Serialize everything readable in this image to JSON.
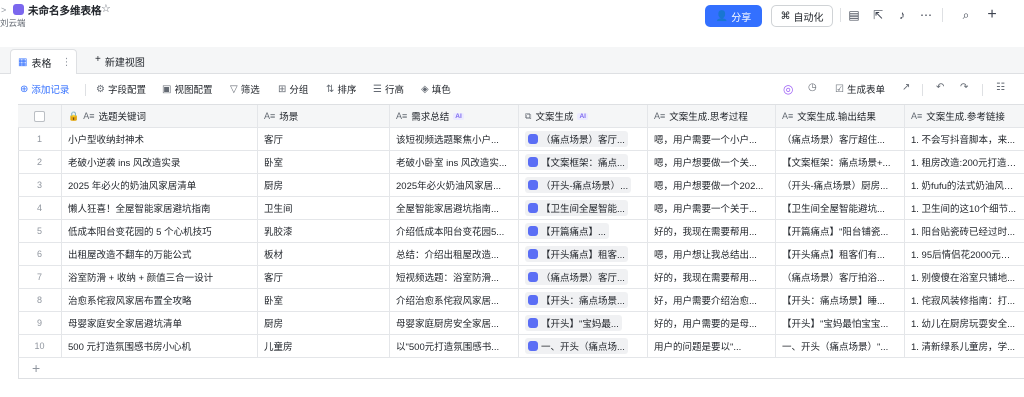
{
  "header": {
    "title": "未命名多维表格",
    "owner": "刘云端",
    "share_label": "分享",
    "automation_label": "自动化"
  },
  "views": {
    "active_tab": "表格",
    "new_view": "新建视图"
  },
  "toolbar": {
    "add_record": "添加记录",
    "field_config": "字段配置",
    "view_config": "视图配置",
    "filter": "筛选",
    "group": "分组",
    "sort": "排序",
    "row_height": "行高",
    "fill_color": "填色",
    "generate_table": "生成表单"
  },
  "columns": [
    {
      "label": "选题关键词",
      "icon": "text-icon",
      "ai": false
    },
    {
      "label": "场景",
      "icon": "text-icon",
      "ai": false
    },
    {
      "label": "需求总结",
      "icon": "text-icon",
      "ai": true
    },
    {
      "label": "文案生成",
      "icon": "copy-icon",
      "ai": true
    },
    {
      "label": "文案生成.思考过程",
      "icon": "text-icon",
      "ai": false
    },
    {
      "label": "文案生成.输出结果",
      "icon": "text-icon",
      "ai": false
    },
    {
      "label": "文案生成.参考链接",
      "icon": "text-icon",
      "ai": false
    }
  ],
  "rows": [
    {
      "n": "1",
      "c1": "小户型收纳封神术",
      "c2": "客厅",
      "c3": "该短视频选题聚焦小户...",
      "c4": "（痛点场景）客厅...",
      "c5": "嗯，用户需要一个小户...",
      "c6": "（痛点场景）客厅超住...",
      "c7": "1. 不会写抖音脚本，来..."
    },
    {
      "n": "2",
      "c1": "老破小逆袭 ins 风改造实录",
      "c2": "卧室",
      "c3": "老破小卧室 ins 风改造实...",
      "c4": "【文案框架：痛点...",
      "c5": "嗯，用户想要做一个关...",
      "c6": "【文案框架：痛点场景+...",
      "c7": "1. 租房改造:200元打造in..."
    },
    {
      "n": "3",
      "c1": "2025 年必火的奶油风家居清单",
      "c2": "厨房",
      "c3": "2025年必火奶油风家居...",
      "c4": "（开头-痛点场景）...",
      "c5": "嗯，用户想要做一个202...",
      "c6": "（开头-痛点场景）厨房...",
      "c7": "1. 奶fufu的法式奶油风厨..."
    },
    {
      "n": "4",
      "c1": "懒人狂喜！全屋智能家居避坑指南",
      "c2": "卫生间",
      "c3": "全屋智能家居避坑指南...",
      "c4": "【卫生间全屋智能...",
      "c5": "嗯，用户需要一个关于...",
      "c6": "【卫生间全屋智能避坑...",
      "c7": "1. 卫生间的这10个细节..."
    },
    {
      "n": "5",
      "c1": "低成本阳台变花园的 5 个心机技巧",
      "c2": "乳胶漆",
      "c3": "介绍低成本阳台变花园5...",
      "c4": "【开篇痛点】...",
      "c5": "好的，我现在需要帮用...",
      "c6": "【开篇痛点】\"阳台铺瓷...",
      "c7": "1. 阳台贴瓷砖已经过时..."
    },
    {
      "n": "6",
      "c1": "出租屋改造不翻车的万能公式",
      "c2": "板材",
      "c3": "总结：介绍出租屋改造...",
      "c4": "【开头痛点】租客...",
      "c5": "嗯，用户想让我总结出...",
      "c6": "【开头痛点】租客们有...",
      "c7": "1. 95后情侣花2000元将..."
    },
    {
      "n": "7",
      "c1": "浴室防滑 + 收纳 + 颜值三合一设计",
      "c2": "客厅",
      "c3": "短视频选题：浴室防滑...",
      "c4": "（痛点场景）客厅...",
      "c5": "好的，我现在需要帮用...",
      "c6": "（痛点场景）客厅拍浴...",
      "c7": "1. 别傻傻在浴室只铺地..."
    },
    {
      "n": "8",
      "c1": "治愈系侘寂风家居布置全攻略",
      "c2": "卧室",
      "c3": "介绍治愈系侘寂风家居...",
      "c4": "【开头：痛点场景...",
      "c5": "好，用户需要介绍治愈...",
      "c6": "【开头：痛点场景】睡...",
      "c7": "1. 侘寂风装修指南：打..."
    },
    {
      "n": "9",
      "c1": "母婴家庭安全家居避坑清单",
      "c2": "厨房",
      "c3": "母婴家庭厨房安全家居...",
      "c4": "【开头】\"宝妈最...",
      "c5": "好的，用户需要的是母...",
      "c6": "【开头】\"宝妈最怕宝宝...",
      "c7": "1. 幼儿在厨房玩耍安全..."
    },
    {
      "n": "10",
      "c1": "500 元打造氛围感书房小心机",
      "c2": "儿童房",
      "c3": "以\"500元打造氛围感书...",
      "c4": "一、开头（痛点场...",
      "c5": "用户的问题是要以\"...",
      "c6": "一、开头（痛点场景）\"...",
      "c7": "1. 清新绿系儿童房，学..."
    }
  ],
  "colors": {
    "accent": "#3370ff",
    "ai_purple": "#7b67ee"
  }
}
